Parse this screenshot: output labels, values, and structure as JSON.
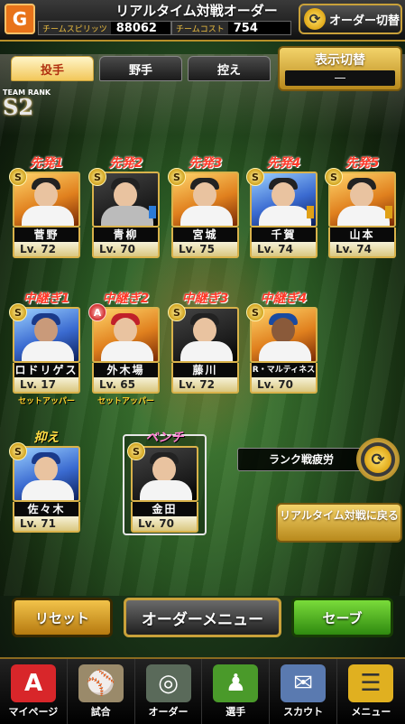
{
  "header": {
    "title": "リアルタイム対戦オーダー",
    "team_spirit_label": "チームスピリッツ",
    "team_spirit_value": "88062",
    "team_cost_label": "チームコスト",
    "team_cost_value": "754",
    "order_switch_label": "オーダー切替"
  },
  "tabs": [
    {
      "label": "投手",
      "active": true
    },
    {
      "label": "野手",
      "active": false
    },
    {
      "label": "控え",
      "active": false
    }
  ],
  "display_switch": {
    "label": "表示切替",
    "value": "―"
  },
  "team_rank": {
    "label": "TEAM RANK",
    "value": "S2"
  },
  "starters": [
    {
      "position": "先発1",
      "name": "菅野",
      "level": "Lv. 72",
      "badge": "S"
    },
    {
      "position": "先発2",
      "name": "青柳",
      "level": "Lv. 70",
      "badge": "S"
    },
    {
      "position": "先発3",
      "name": "宮城",
      "level": "Lv. 75",
      "badge": "S"
    },
    {
      "position": "先発4",
      "name": "千賀",
      "level": "Lv. 74",
      "badge": "S"
    },
    {
      "position": "先発5",
      "name": "山本",
      "level": "Lv. 74",
      "badge": "S"
    }
  ],
  "relievers": [
    {
      "position": "中継ぎ1",
      "name": "ロドリゲス",
      "level": "Lv. 17",
      "badge": "S",
      "note": "セットアッパー"
    },
    {
      "position": "中継ぎ2",
      "name": "外木場",
      "level": "Lv. 65",
      "badge": "A",
      "note": "セットアッパー"
    },
    {
      "position": "中継ぎ3",
      "name": "藤川",
      "level": "Lv. 72",
      "badge": "S",
      "note": ""
    },
    {
      "position": "中継ぎ4",
      "name": "R・マルティネス",
      "level": "Lv. 70",
      "badge": "S",
      "note": ""
    }
  ],
  "closer": {
    "position": "抑え",
    "name": "佐々木",
    "level": "Lv. 71",
    "badge": "S"
  },
  "bench": {
    "position": "ベンチ",
    "name": "金田",
    "level": "Lv. 70",
    "badge": "S"
  },
  "fatigue_label": "ランク戦疲労",
  "return_button": "リアルタイム対戦に戻る",
  "buttons": {
    "reset": "リセット",
    "order_menu": "オーダーメニュー",
    "save": "セーブ"
  },
  "nav": [
    {
      "label": "マイページ",
      "icon": "A",
      "color": "#d8262a"
    },
    {
      "label": "試合",
      "icon": "⚾",
      "color": "#9a8a6a"
    },
    {
      "label": "オーダー",
      "icon": "◎",
      "color": "#5a6a5a"
    },
    {
      "label": "選手",
      "icon": "♟",
      "color": "#4a9a2a"
    },
    {
      "label": "スカウト",
      "icon": "✉",
      "color": "#5a7ab0"
    },
    {
      "label": "メニュー",
      "icon": "☰",
      "color": "#e0b020"
    }
  ]
}
